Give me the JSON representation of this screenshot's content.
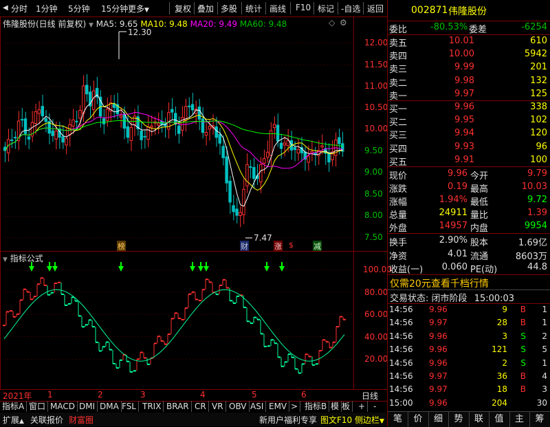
{
  "toolbar": {
    "items_left": [
      "分时",
      "1分钟",
      "5分钟",
      "15分钟",
      "更多"
    ],
    "items_right": [
      "复权",
      "叠加",
      "多股",
      "统计",
      "画线",
      "F10",
      "标记",
      "-自选",
      "返回"
    ]
  },
  "stock": {
    "code": "002871",
    "name": "伟隆股份"
  },
  "chart_header": {
    "title": "伟隆股份(日线 前复权)",
    "ma5": "MA5: 9.65",
    "ma10": "MA10: 9.48",
    "ma20": "MA20: 9.49",
    "ma60": "MA60: 9.48",
    "high_label": "12.30",
    "low_label": "7.47"
  },
  "price_axis": [
    "12.00",
    "11.50",
    "11.00",
    "10.50",
    "10.00",
    "9.50",
    "9.00",
    "8.50",
    "8.00",
    "7.50"
  ],
  "event_tags": [
    "榜",
    "财",
    "涨",
    "$",
    "减"
  ],
  "indicator": {
    "title": "指标公式",
    "axis": [
      "100.00",
      "80.00",
      "60.00",
      "40.00",
      "20.00"
    ]
  },
  "date_axis": {
    "year": "2021年",
    "months": [
      "1",
      "2",
      "3",
      "4",
      "5",
      "6"
    ],
    "period": "日线"
  },
  "indicator_tabs": [
    "指标A",
    "窗口",
    "MACD",
    "DMI",
    "DMA",
    "FSL",
    "TRIX",
    "BRAR",
    "CR",
    "VR",
    "OBV",
    "ASI",
    "EMV",
    ">",
    "指标B",
    "模",
    "板",
    "+",
    "-"
  ],
  "bottom_bar": {
    "left": [
      "扩展",
      "关联报价",
      "财富圈"
    ],
    "right": [
      "新用户福利专享",
      "图文F10",
      "侧边栏"
    ]
  },
  "quote": {
    "weibi": {
      "label": "委比",
      "value": "-80.53%",
      "label2": "委差",
      "value2": "-6254"
    },
    "asks": [
      {
        "label": "卖五",
        "price": "10.01",
        "vol": "610"
      },
      {
        "label": "卖四",
        "price": "10.00",
        "vol": "5942"
      },
      {
        "label": "卖三",
        "price": "9.99",
        "vol": "201"
      },
      {
        "label": "卖二",
        "price": "9.98",
        "vol": "132"
      },
      {
        "label": "卖一",
        "price": "9.97",
        "vol": "125"
      }
    ],
    "bids": [
      {
        "label": "买一",
        "price": "9.96",
        "vol": "338"
      },
      {
        "label": "买二",
        "price": "9.95",
        "vol": "102"
      },
      {
        "label": "买三",
        "price": "9.94",
        "vol": "120"
      },
      {
        "label": "买四",
        "price": "9.93",
        "vol": "96"
      },
      {
        "label": "买五",
        "price": "9.91",
        "vol": "100"
      }
    ],
    "stats": [
      {
        "l1": "现价",
        "v1": "9.96",
        "l2": "今开",
        "v2": "9.79",
        "c1": "#ff3030",
        "c2": "#ff3030"
      },
      {
        "l1": "涨跌",
        "v1": "0.19",
        "l2": "最高",
        "v2": "10.03",
        "c1": "#ff3030",
        "c2": "#ff3030"
      },
      {
        "l1": "涨幅",
        "v1": "1.94%",
        "l2": "最低",
        "v2": "9.72",
        "c1": "#ff3030",
        "c2": "#00ff00"
      },
      {
        "l1": "总量",
        "v1": "24911",
        "l2": "量比",
        "v2": "1.39",
        "c1": "#ffff00",
        "c2": "#ff3030"
      },
      {
        "l1": "外盘",
        "v1": "14957",
        "l2": "内盘",
        "v2": "9954",
        "c1": "#ff3030",
        "c2": "#00ff00"
      }
    ],
    "fund": [
      {
        "l1": "换手",
        "v1": "2.90%",
        "l2": "股本",
        "v2": "1.69亿"
      },
      {
        "l1": "净资",
        "v1": "4.01",
        "l2": "流通",
        "v2": "8603万"
      },
      {
        "l1": "收益(一)",
        "v1": "0.060",
        "l2": "PE(动)",
        "v2": "44.8"
      }
    ],
    "promo": "仅需20元查看千档行情",
    "trade_status": {
      "label": "交易状态:",
      "value": "闭市阶段",
      "time": "15:00:03"
    },
    "ticks": [
      {
        "t": "14:56",
        "p": "9.96",
        "v": "9",
        "d": "B",
        "n": "1"
      },
      {
        "t": "14:56",
        "p": "9.97",
        "v": "28",
        "d": "B",
        "n": "1"
      },
      {
        "t": "14:56",
        "p": "9.96",
        "v": "3",
        "d": "S",
        "n": "2"
      },
      {
        "t": "14:56",
        "p": "9.96",
        "v": "121",
        "d": "S",
        "n": "5"
      },
      {
        "t": "14:56",
        "p": "9.96",
        "v": "2",
        "d": "S",
        "n": "1"
      },
      {
        "t": "14:56",
        "p": "9.97",
        "v": "36",
        "d": "B",
        "n": "4"
      },
      {
        "t": "14:56",
        "p": "9.97",
        "v": "18",
        "d": "B",
        "n": "3"
      },
      {
        "t": "15:00",
        "p": "9.96",
        "v": "204",
        "d": "",
        "n": "30"
      }
    ],
    "right_tabs": [
      "笔",
      "价",
      "细",
      "势",
      "联",
      "值",
      "主",
      "筹"
    ]
  },
  "colors": {
    "up": "#ff3030",
    "down": "#00ff00",
    "cyan": "#00c0c0",
    "ma5": "#ffffff",
    "ma10": "#ffff00",
    "ma20": "#ff00ff",
    "ma60": "#00ff00"
  }
}
